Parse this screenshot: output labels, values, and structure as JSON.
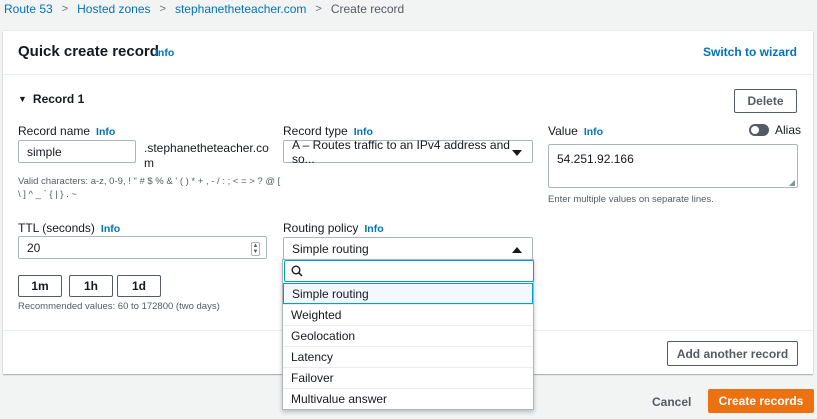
{
  "breadcrumb": {
    "items": [
      "Route 53",
      "Hosted zones",
      "stephanetheteacher.com"
    ],
    "current": "Create record"
  },
  "card": {
    "title": "Quick create record",
    "info": "Info",
    "switch_wizard": "Switch to wizard"
  },
  "record": {
    "title": "Record 1",
    "delete_label": "Delete",
    "name_label": "Record name",
    "name_info": "Info",
    "name_value": "simple",
    "domain_suffix_line1": ".stephanetheteacher.co",
    "domain_suffix_line2": "m",
    "valid_chars_line1": "Valid characters: a-z, 0-9, ! \" # $ % & ' ( ) * + , - / : ; < = > ? @ [",
    "valid_chars_line2": "\\ ] ^ _ ` { | } . ~",
    "type_label": "Record type",
    "type_info": "Info",
    "type_value": "A – Routes traffic to an IPv4 address and so...",
    "value_label": "Value",
    "value_info": "Info",
    "alias_label": "Alias",
    "value_text": "54.251.92.166",
    "value_hint": "Enter multiple values on separate lines.",
    "ttl_label": "TTL (seconds)",
    "ttl_info": "Info",
    "ttl_value": "20",
    "ttl_buttons": [
      "1m",
      "1h",
      "1d"
    ],
    "ttl_hint": "Recommended values: 60 to 172800 (two days)",
    "routing_label": "Routing policy",
    "routing_info": "Info",
    "routing_value": "Simple routing"
  },
  "routing_options": [
    "Simple routing",
    "Weighted",
    "Geolocation",
    "Latency",
    "Failover",
    "Multivalue answer"
  ],
  "add_another": "Add another record",
  "footer": {
    "cancel": "Cancel",
    "create": "Create records"
  },
  "colors": {
    "link": "#0073bb",
    "primary": "#ec7211",
    "focus": "#00a1c9"
  }
}
